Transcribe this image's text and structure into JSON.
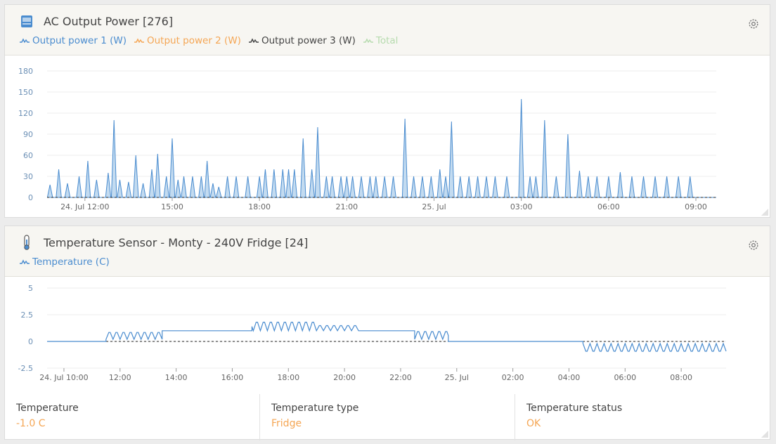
{
  "panel1": {
    "title": "AC Output Power [276]",
    "legend": [
      {
        "label": "Output power 1 (W)",
        "color": "#4a8ccf"
      },
      {
        "label": "Output power 2 (W)",
        "color": "#f5a654"
      },
      {
        "label": "Output power 3 (W)",
        "color": "#444444"
      },
      {
        "label": "Total",
        "color": "#b6dbae"
      }
    ],
    "icon": "inverter-icon"
  },
  "panel2": {
    "title": "Temperature Sensor - Monty - 240V Fridge [24]",
    "legend": [
      {
        "label": "Temperature (C)",
        "color": "#4a8ccf"
      }
    ],
    "icon": "thermometer-icon",
    "stats": [
      {
        "label": "Temperature",
        "value": "-1.0 C"
      },
      {
        "label": "Temperature type",
        "value": "Fridge"
      },
      {
        "label": "Temperature status",
        "value": "OK"
      }
    ]
  },
  "chart_data": [
    {
      "type": "area",
      "title": "AC Output Power [276]",
      "ylim": [
        0,
        180
      ],
      "yticks": [
        "180",
        "150",
        "120",
        "90",
        "60",
        "30",
        "0"
      ],
      "xticks": [
        "24. Jul 12:00",
        "15:00",
        "18:00",
        "21:00",
        "25. Jul",
        "03:00",
        "06:00",
        "09:00"
      ],
      "x_range_hours": [
        10.7,
        33.7
      ],
      "baseline": 0,
      "series": [
        {
          "name": "Output power 1 (W)",
          "peaks": [
            [
              10.8,
              18
            ],
            [
              11.1,
              40
            ],
            [
              11.4,
              20
            ],
            [
              11.8,
              30
            ],
            [
              12.1,
              52
            ],
            [
              12.4,
              25
            ],
            [
              12.8,
              35
            ],
            [
              13.0,
              110
            ],
            [
              13.2,
              25
            ],
            [
              13.5,
              22
            ],
            [
              13.75,
              60
            ],
            [
              14.0,
              20
            ],
            [
              14.3,
              40
            ],
            [
              14.5,
              62
            ],
            [
              14.8,
              30
            ],
            [
              15.0,
              84
            ],
            [
              15.2,
              25
            ],
            [
              15.4,
              30
            ],
            [
              15.7,
              30
            ],
            [
              16.0,
              30
            ],
            [
              16.2,
              52
            ],
            [
              16.4,
              20
            ],
            [
              16.6,
              15
            ],
            [
              16.9,
              30
            ],
            [
              17.2,
              30
            ],
            [
              17.6,
              30
            ],
            [
              18.0,
              30
            ],
            [
              18.2,
              40
            ],
            [
              18.5,
              40
            ],
            [
              18.8,
              40
            ],
            [
              19.0,
              40
            ],
            [
              19.2,
              40
            ],
            [
              19.5,
              84
            ],
            [
              19.8,
              40
            ],
            [
              20.0,
              100
            ],
            [
              20.3,
              30
            ],
            [
              20.5,
              30
            ],
            [
              20.8,
              30
            ],
            [
              21.0,
              30
            ],
            [
              21.2,
              30
            ],
            [
              21.5,
              30
            ],
            [
              21.8,
              30
            ],
            [
              22.0,
              30
            ],
            [
              22.3,
              30
            ],
            [
              22.6,
              30
            ],
            [
              23.0,
              112
            ],
            [
              23.3,
              30
            ],
            [
              23.6,
              30
            ],
            [
              23.9,
              30
            ],
            [
              24.2,
              40
            ],
            [
              24.4,
              30
            ],
            [
              24.6,
              108
            ],
            [
              24.9,
              30
            ],
            [
              25.2,
              30
            ],
            [
              25.5,
              30
            ],
            [
              25.8,
              30
            ],
            [
              26.1,
              30
            ],
            [
              26.5,
              30
            ],
            [
              27.0,
              140
            ],
            [
              27.3,
              30
            ],
            [
              27.5,
              30
            ],
            [
              27.8,
              110
            ],
            [
              28.2,
              30
            ],
            [
              28.6,
              90
            ],
            [
              29.0,
              38
            ],
            [
              29.3,
              30
            ],
            [
              29.6,
              30
            ],
            [
              30.0,
              30
            ],
            [
              30.4,
              36
            ],
            [
              30.8,
              30
            ],
            [
              31.2,
              30
            ],
            [
              31.6,
              30
            ],
            [
              32.0,
              30
            ],
            [
              32.4,
              30
            ],
            [
              32.8,
              30
            ]
          ]
        }
      ]
    },
    {
      "type": "line",
      "title": "Temperature Sensor - Monty - 240V Fridge [24]",
      "ylim": [
        -2.5,
        5
      ],
      "yticks": [
        "5",
        "2.5",
        "0",
        "-2.5"
      ],
      "xticks": [
        "24. Jul 10:00",
        "12:00",
        "14:00",
        "16:00",
        "18:00",
        "20:00",
        "22:00",
        "25. Jul",
        "02:00",
        "04:00",
        "06:00",
        "08:00"
      ],
      "x_range_hours": [
        9.4,
        33.6
      ],
      "baseline": 0,
      "segments": [
        {
          "from": 9.4,
          "to": 11.5,
          "base": 0.0,
          "amp": 0.0
        },
        {
          "from": 11.5,
          "to": 13.5,
          "base": 0.2,
          "amp": 0.8
        },
        {
          "from": 13.5,
          "to": 16.7,
          "base": 1.0,
          "amp": 0.0
        },
        {
          "from": 16.7,
          "to": 19.0,
          "base": 1.0,
          "amp": 1.0
        },
        {
          "from": 19.0,
          "to": 20.5,
          "base": 1.0,
          "amp": 0.6
        },
        {
          "from": 20.5,
          "to": 22.5,
          "base": 1.0,
          "amp": 0.0
        },
        {
          "from": 22.5,
          "to": 23.7,
          "base": 0.2,
          "amp": 0.9
        },
        {
          "from": 23.7,
          "to": 28.5,
          "base": 0.0,
          "amp": 0.0
        },
        {
          "from": 28.5,
          "to": 33.6,
          "base": -0.2,
          "amp": -0.9
        }
      ]
    }
  ]
}
